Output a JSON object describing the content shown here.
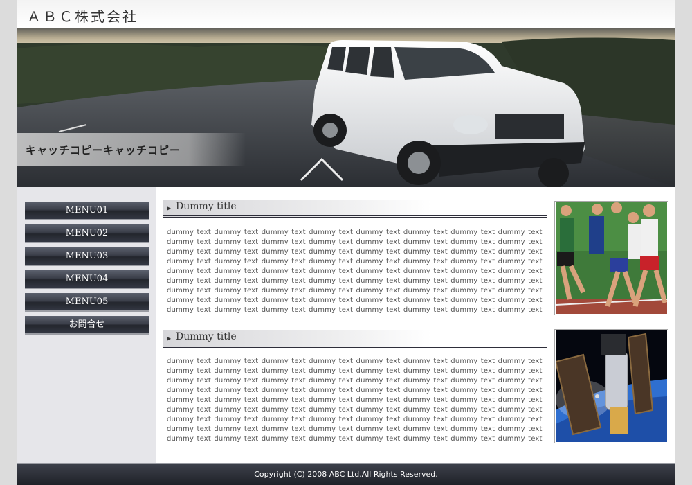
{
  "header": {
    "logo": "ＡＢＣ株式会社"
  },
  "hero": {
    "catch_copy": "キャッチコピーキャッチコピー"
  },
  "sidebar": {
    "items": [
      {
        "label": "MENU01"
      },
      {
        "label": "MENU02"
      },
      {
        "label": "MENU03"
      },
      {
        "label": "MENU04"
      },
      {
        "label": "MENU05"
      },
      {
        "label": "お問合せ"
      }
    ]
  },
  "sections": [
    {
      "title": "Dummy title",
      "lines": [
        "dummy text dummy text dummy text dummy text dummy text dummy text dummy text dummy text",
        "dummy text dummy text dummy text dummy text dummy text dummy text dummy text dummy text",
        "dummy text dummy text dummy text dummy text dummy text dummy text dummy text dummy text",
        "dummy text dummy text dummy text dummy text dummy text dummy text dummy text dummy text",
        "dummy text dummy text dummy text dummy text dummy text dummy text dummy text dummy text",
        "dummy text dummy text dummy text dummy text dummy text dummy text dummy text dummy text",
        "dummy text dummy text dummy text dummy text dummy text dummy text dummy text dummy text",
        "dummy text dummy text dummy text dummy text dummy text dummy text dummy text dummy text",
        "dummy text dummy text dummy text dummy text dummy text dummy text dummy text dummy text"
      ]
    },
    {
      "title": "Dummy title",
      "lines": [
        "dummy text dummy text dummy text dummy text dummy text dummy text dummy text dummy text",
        "dummy text dummy text dummy text dummy text dummy text dummy text dummy text dummy text",
        "dummy text dummy text dummy text dummy text dummy text dummy text dummy text dummy text",
        "dummy text dummy text dummy text dummy text dummy text dummy text dummy text dummy text",
        "dummy text dummy text dummy text dummy text dummy text dummy text dummy text dummy text",
        "dummy text dummy text dummy text dummy text dummy text dummy text dummy text dummy text",
        "dummy text dummy text dummy text dummy text dummy text dummy text dummy text dummy text",
        "dummy text dummy text dummy text dummy text dummy text dummy text dummy text dummy text",
        "dummy text dummy text dummy text dummy text dummy text dummy text dummy text dummy text"
      ]
    }
  ],
  "footer": {
    "copyright": "Copyright (C) 2008 ABC Ltd.All Rights Reserved."
  },
  "colors": {
    "menu_dark": "#23262d",
    "sidebar_bg": "#e6e6ea",
    "footer_bg": "#1f2228"
  }
}
